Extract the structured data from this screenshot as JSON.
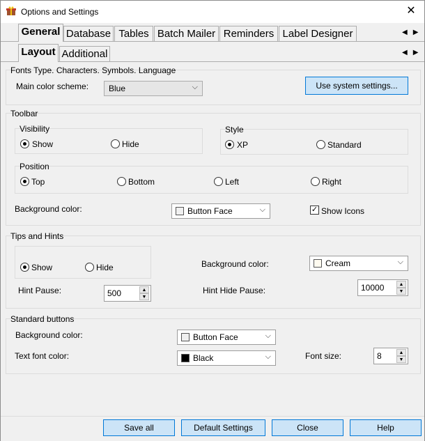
{
  "window": {
    "title": "Options and Settings",
    "close_glyph": "✕",
    "app_icon": "gift-box-icon"
  },
  "main_tabs": [
    "General",
    "Database",
    "Tables",
    "Batch Mailer",
    "Reminders",
    "Label Designer"
  ],
  "sub_tabs": [
    "Layout",
    "Additional"
  ],
  "arrows": {
    "left": "◀",
    "right": "▶"
  },
  "fonts_section": {
    "title": "Fonts Type. Characters. Symbols. Language",
    "scheme_label": "Main color scheme:",
    "scheme_value": "Blue",
    "system_button": "Use system settings..."
  },
  "toolbar": {
    "title": "Toolbar",
    "visibility_label": "Visibility",
    "show": "Show",
    "hide": "Hide",
    "style_label": "Style",
    "xp": "XP",
    "standard": "Standard",
    "position_label": "Position",
    "top": "Top",
    "bottom": "Bottom",
    "left": "Left",
    "right": "Right",
    "bg_label": "Background color:",
    "bg_value": "Button Face",
    "show_icons": "Show Icons",
    "show_icons_checked": true
  },
  "tips": {
    "title": "Tips and Hints",
    "show": "Show",
    "hide": "Hide",
    "bg_label": "Background color:",
    "bg_value": "Cream",
    "hint_pause_label": "Hint Pause:",
    "hint_pause_value": "500",
    "hint_hide_label": "Hint Hide Pause:",
    "hint_hide_value": "10000"
  },
  "standard_buttons": {
    "title": "Standard buttons",
    "bg_label": "Background color:",
    "bg_value": "Button Face",
    "text_color_label": "Text font color:",
    "text_color_value": "Black",
    "font_size_label": "Font size:",
    "font_size_value": "8"
  },
  "footer": {
    "save_all": "Save all",
    "default": "Default Settings",
    "close": "Close",
    "help": "Help"
  },
  "colors": {
    "button_face": "#f0f0f0",
    "cream": "#fffbf0",
    "black": "#000000",
    "accent": "#0078d7"
  }
}
